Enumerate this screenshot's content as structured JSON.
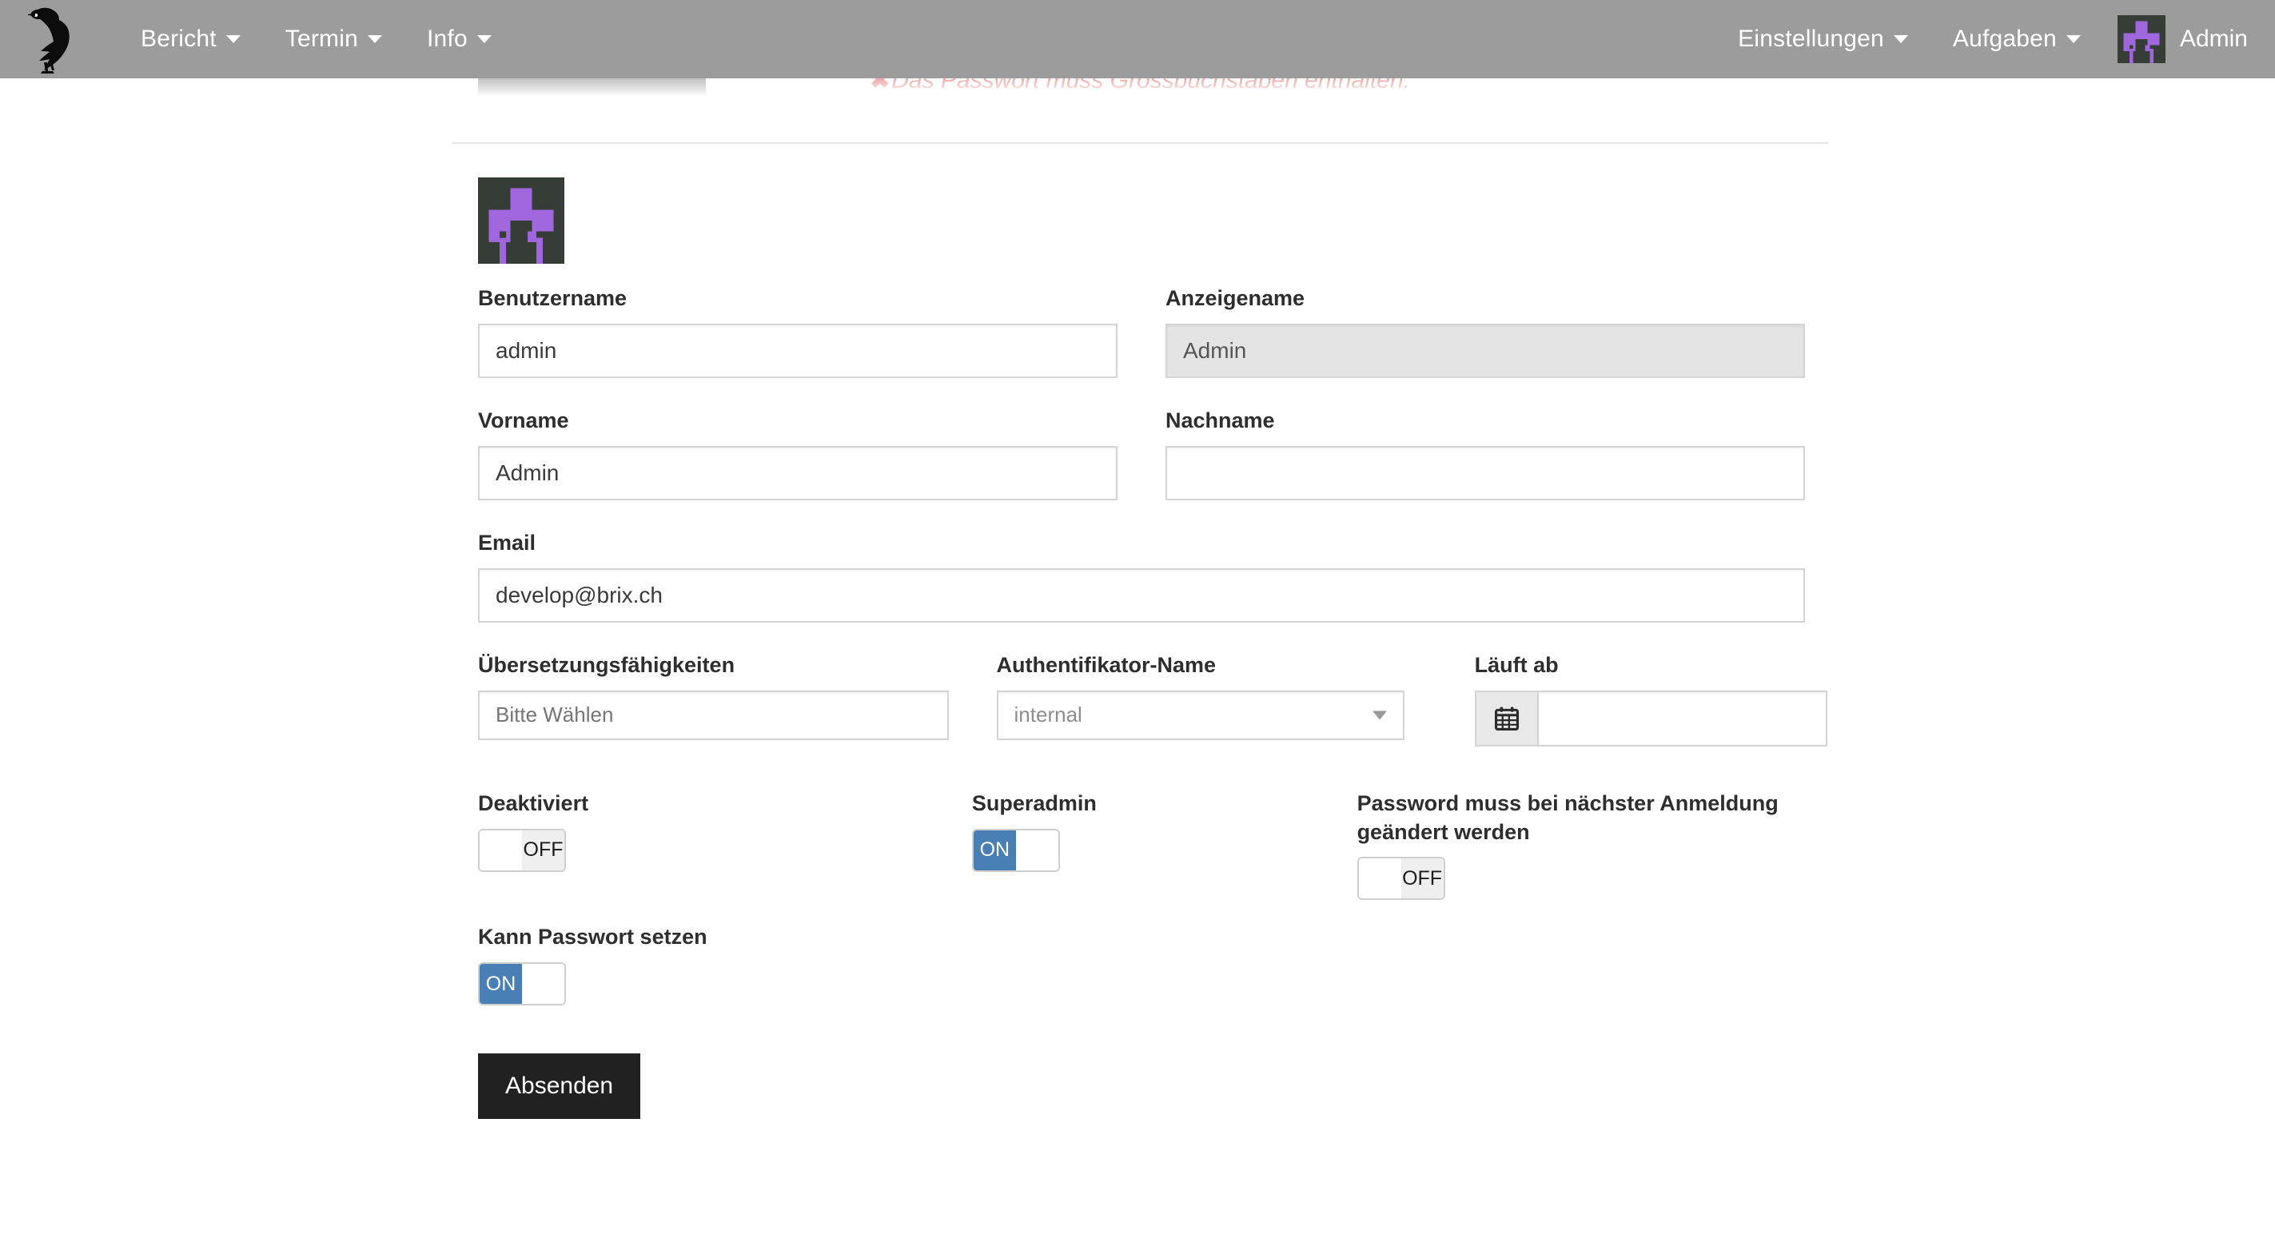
{
  "navbar": {
    "logo_icon": "magpie-bird-logo",
    "brand_color": "#9c9c9c",
    "left_items": [
      {
        "label": "Bericht",
        "icon": "chevron-down-icon"
      },
      {
        "label": "Termin",
        "icon": "chevron-down-icon"
      },
      {
        "label": "Info",
        "icon": "chevron-down-icon"
      }
    ],
    "right_items": [
      {
        "label": "Einstellungen",
        "icon": "chevron-down-icon"
      },
      {
        "label": "Aufgaben",
        "icon": "chevron-down-icon"
      }
    ],
    "user": {
      "name": "Admin",
      "avatar_icon": "identicon-avatar",
      "avatar_bg": "#363d36",
      "avatar_fg": "#a066dd"
    }
  },
  "flash": {
    "icon": "error-x-icon",
    "icon_glyph": "✖",
    "message": "Das Passwort muss Grossbuchstaben enthalten.",
    "color": "#d9534f"
  },
  "profile": {
    "avatar_icon": "identicon-avatar",
    "avatar_bg": "#363d36",
    "avatar_fg": "#a066dd"
  },
  "form": {
    "username": {
      "label": "Benutzername",
      "value": "admin"
    },
    "displayname": {
      "label": "Anzeigename",
      "value": "Admin",
      "disabled": true
    },
    "firstname": {
      "label": "Vorname",
      "value": "Admin"
    },
    "lastname": {
      "label": "Nachname",
      "value": ""
    },
    "email": {
      "label": "Email",
      "value": "develop@brix.ch"
    },
    "translation": {
      "label": "Übersetzungsfähigkeiten",
      "placeholder": "Bitte Wählen",
      "value": ""
    },
    "authenticator": {
      "label": "Authentifikator-Name",
      "value": "internal",
      "options": [
        "internal"
      ],
      "icon": "chevron-down-icon"
    },
    "expires": {
      "label": "Läuft ab",
      "value": "",
      "icon": "calendar-icon"
    },
    "toggles": [
      {
        "label": "Deaktiviert",
        "state": "OFF",
        "on": false
      },
      {
        "label": "Superadmin",
        "state": "ON",
        "on": true
      },
      {
        "label": "Password muss bei nächster Anmeldung geändert werden",
        "state": "OFF",
        "on": false
      },
      {
        "label": "Kann Passwort setzen",
        "state": "ON",
        "on": true
      }
    ],
    "toggle_on_label": "ON",
    "toggle_off_label": "OFF",
    "submit": {
      "label": "Absenden",
      "color": "#212121"
    }
  }
}
